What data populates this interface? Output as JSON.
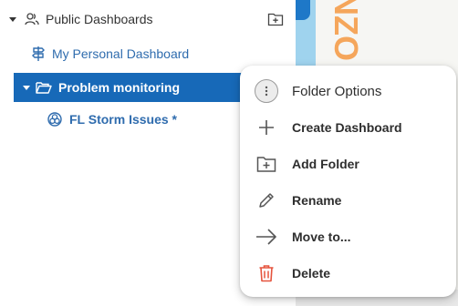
{
  "tree": {
    "root_label": "Public Dashboards",
    "items": [
      {
        "label": "My Personal Dashboard"
      },
      {
        "label": "Problem monitoring"
      },
      {
        "label": "FL Storm Issues *"
      }
    ]
  },
  "background": {
    "orange_text": "UNZO"
  },
  "context_menu": {
    "title": "Folder Options",
    "items": [
      {
        "label": "Create Dashboard",
        "icon": "plus-icon"
      },
      {
        "label": "Add Folder",
        "icon": "folder-plus-icon"
      },
      {
        "label": "Rename",
        "icon": "pencil-icon"
      },
      {
        "label": "Move to...",
        "icon": "arrow-right-icon"
      },
      {
        "label": "Delete",
        "icon": "trash-icon",
        "color": "#e5533d"
      }
    ]
  },
  "colors": {
    "selected_bg": "#1769b8",
    "link": "#2f6cae",
    "delete": "#e5533d"
  }
}
